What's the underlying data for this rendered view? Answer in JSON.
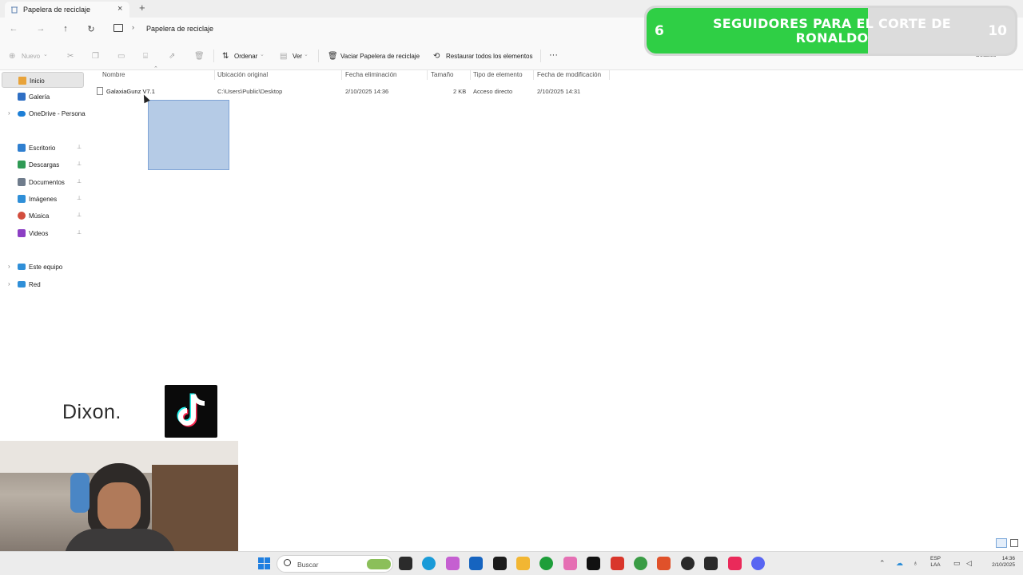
{
  "window": {
    "tab_title": "Papelera de reciclaje",
    "new_tab_glyph": "+",
    "close_glyph": "×"
  },
  "addressbar": {
    "breadcrumb": "Papelera de reciclaje",
    "chevron": "›",
    "nav_icons": [
      "back-arrow-icon",
      "forward-arrow-icon",
      "up-arrow-icon",
      "refresh-icon",
      "this-pc-icon"
    ]
  },
  "commandbar": {
    "new_label": "Nuevo",
    "sort_label": "Ordenar",
    "view_label": "Ver",
    "empty_bin_label": "Vaciar Papelera de reciclaje",
    "restore_all_label": "Restaurar todos los elementos",
    "more_label": "···",
    "details_label": "Detalles"
  },
  "sidebar": {
    "items": [
      {
        "label": "Inicio",
        "icon": "home-icon",
        "color": "#e8a33a"
      },
      {
        "label": "Galería",
        "icon": "gallery-icon",
        "color": "#2f6fc4"
      },
      {
        "label": "OneDrive - Persona",
        "icon": "onedrive-icon",
        "color": "#1d7fd6"
      },
      {
        "label": "Escritorio",
        "icon": "desktop-icon",
        "color": "#2f7fd0"
      },
      {
        "label": "Descargas",
        "icon": "download-icon",
        "color": "#2f9a55"
      },
      {
        "label": "Documentos",
        "icon": "documents-icon",
        "color": "#6f7c8c"
      },
      {
        "label": "Imágenes",
        "icon": "pictures-icon",
        "color": "#2f8fd8"
      },
      {
        "label": "Música",
        "icon": "music-icon",
        "color": "#d24d3d"
      },
      {
        "label": "Videos",
        "icon": "videos-icon",
        "color": "#8c3fc4"
      },
      {
        "label": "Este equipo",
        "icon": "this-pc-icon",
        "color": "#2f8fd8"
      },
      {
        "label": "Red",
        "icon": "network-icon",
        "color": "#2f8fd8"
      }
    ],
    "pin_glyph": "📌",
    "expand_glyph": "›"
  },
  "table": {
    "columns": [
      "Nombre",
      "Ubicación original",
      "Fecha eliminación",
      "Tamaño",
      "Tipo de elemento",
      "Fecha de modificación"
    ],
    "rows": [
      {
        "name": "GalaxiaGunz V7.1",
        "original_location": "C:\\Users\\Public\\Desktop",
        "deleted_date": "2/10/2025 14:36",
        "size": "2 KB",
        "type": "Acceso directo",
        "modified_date": "2/10/2025 14:31"
      }
    ]
  },
  "overlay": {
    "banner": {
      "current": "6",
      "goal": "10",
      "progress": 0.6,
      "text": "SEGUIDORES PARA EL CORTE DE RONALDO",
      "fill_color": "#2fcf45"
    },
    "streamer_name": "Dixon.",
    "tiktok_icon": "tiktok-logo-icon"
  },
  "taskbar": {
    "search_placeholder": "Buscar",
    "lang_line1": "ESP",
    "lang_line2": "LAA",
    "time": "14:36",
    "date": "2/10/2025",
    "apps": [
      {
        "name": "start-icon",
        "color": "#1f7fe0"
      },
      {
        "name": "task-view-icon",
        "color": "#2b2b2b"
      },
      {
        "name": "edge-icon",
        "color": "#1a9bd8"
      },
      {
        "name": "copilot-icon",
        "color": "#c55fd1"
      },
      {
        "name": "outlook-icon",
        "color": "#1664c0"
      },
      {
        "name": "capcut-icon",
        "color": "#1b1b1b"
      },
      {
        "name": "file-explorer-icon",
        "color": "#f2b632"
      },
      {
        "name": "xbox-icon",
        "color": "#1e9e3a"
      },
      {
        "name": "itunes-icon",
        "color": "#e56fb3"
      },
      {
        "name": "tiktok-icon",
        "color": "#111111"
      },
      {
        "name": "typora-icon",
        "color": "#d9362b"
      },
      {
        "name": "chrome-icon",
        "color": "#3a9c45"
      },
      {
        "name": "brave-icon",
        "color": "#e0512a"
      },
      {
        "name": "obs-icon",
        "color": "#2a2a2a"
      },
      {
        "name": "github-desktop-icon",
        "color": "#2a2a2a"
      },
      {
        "name": "tiktok-live-icon",
        "color": "#ea2a5a"
      },
      {
        "name": "discord-icon",
        "color": "#5865f2"
      }
    ]
  }
}
